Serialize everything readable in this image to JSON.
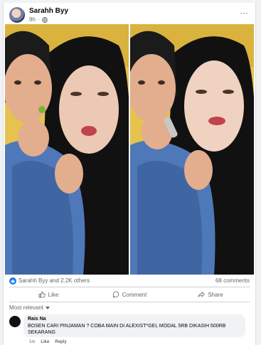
{
  "post": {
    "author": "Sarahh Byy",
    "time": "9h",
    "privacy_icon": "globe-icon",
    "more_icon": "more-icon"
  },
  "reactions": {
    "summary": "Sarahh Byy and 2.2K others",
    "comments": "68 comments",
    "like_color": "#1877f2"
  },
  "actions": {
    "like": "Like",
    "comment": "Comment",
    "share": "Share"
  },
  "comments_section": {
    "sort_label": "Most relevant",
    "items": [
      {
        "author": "Rais Na",
        "text": "BOSEN CARI PINJAMAN ? COBA MAIN DI ALEXIST*GEL MODAL 5RB DIKASIH 500RB SEKARANG",
        "time": "1m",
        "like": "Like",
        "reply": "Reply"
      }
    ]
  }
}
